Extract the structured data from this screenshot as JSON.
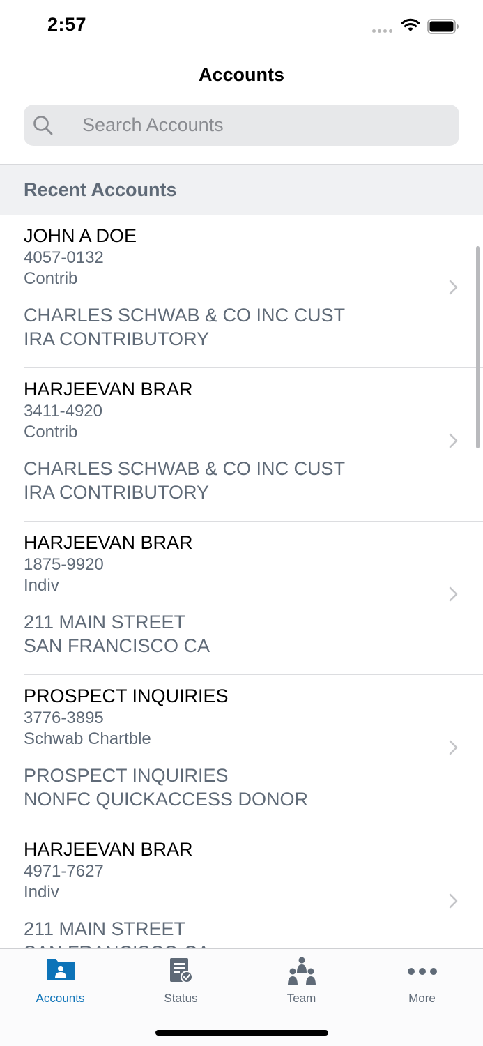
{
  "status_bar": {
    "time": "2:57"
  },
  "nav": {
    "title": "Accounts"
  },
  "search": {
    "placeholder": "Search Accounts",
    "value": ""
  },
  "section": {
    "title": "Recent Accounts"
  },
  "accounts": [
    {
      "name": "JOHN A DOE",
      "number": "4057-0132",
      "type": "Contrib",
      "line1": "CHARLES SCHWAB & CO INC CUST",
      "line2": "IRA CONTRIBUTORY"
    },
    {
      "name": "HARJEEVAN BRAR",
      "number": "3411-4920",
      "type": "Contrib",
      "line1": "CHARLES SCHWAB & CO INC CUST",
      "line2": "IRA CONTRIBUTORY"
    },
    {
      "name": "HARJEEVAN BRAR",
      "number": "1875-9920",
      "type": "Indiv",
      "line1": "211 MAIN STREET",
      "line2": "SAN FRANCISCO CA"
    },
    {
      "name": "PROSPECT INQUIRIES",
      "number": "3776-3895",
      "type": "Schwab Chartble",
      "line1": "PROSPECT INQUIRIES",
      "line2": "NONFC QUICKACCESS DONOR"
    },
    {
      "name": "HARJEEVAN BRAR",
      "number": "4971-7627",
      "type": "Indiv",
      "line1": "211 MAIN STREET",
      "line2": "SAN FRANCISCO CA"
    }
  ],
  "tabs": [
    {
      "label": "Accounts",
      "icon": "accounts-folder-icon",
      "active": true
    },
    {
      "label": "Status",
      "icon": "status-clipboard-icon",
      "active": false
    },
    {
      "label": "Team",
      "icon": "team-people-icon",
      "active": false
    },
    {
      "label": "More",
      "icon": "more-dots-icon",
      "active": false
    }
  ],
  "colors": {
    "accent": "#0d73b8",
    "secondary_text": "#5f6a77",
    "search_bg": "#e7e8ea",
    "section_bg": "#f0f1f3"
  }
}
